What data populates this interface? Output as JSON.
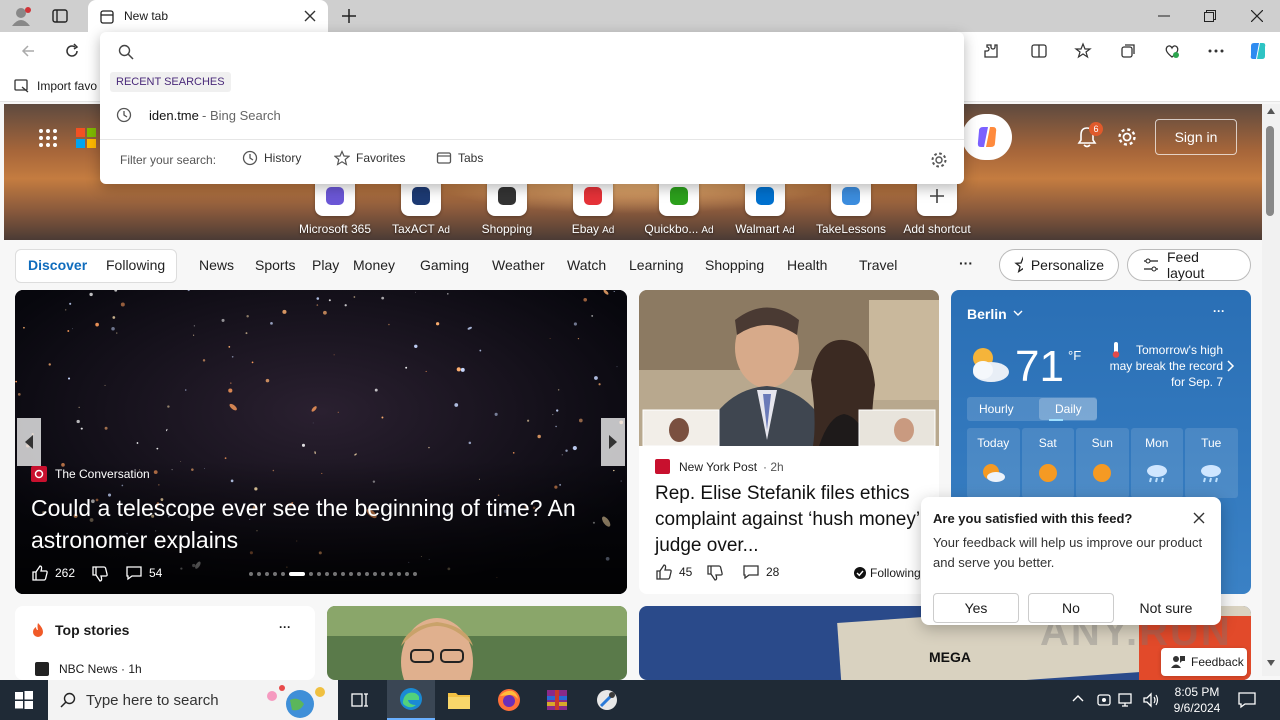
{
  "browser": {
    "tab_title": "New tab",
    "import_favorites": "Import favo"
  },
  "search": {
    "recent_heading": "RECENT SEARCHES",
    "recent": [
      {
        "query": "iden.tme",
        "suffix": " - Bing Search"
      }
    ],
    "filter_label": "Filter your search:",
    "filters": [
      "History",
      "Favorites",
      "Tabs"
    ]
  },
  "hero": {
    "notification_count": "6",
    "sign_in": "Sign in",
    "shortcuts": [
      {
        "label": "Microsoft 365",
        "ad": "",
        "icon": "microsoft365-icon",
        "color": "#6b57d6"
      },
      {
        "label": "TaxACT",
        "ad": "Ad",
        "icon": "taxact-icon",
        "color": "#1d3a73"
      },
      {
        "label": "Shopping",
        "ad": "",
        "icon": "shopping-tag-icon",
        "color": "#333"
      },
      {
        "label": "Ebay",
        "ad": "Ad",
        "icon": "ebay-icon",
        "color": "#e53238"
      },
      {
        "label": "Quickbo...",
        "ad": "Ad",
        "icon": "quickbooks-icon",
        "color": "#2ca01c"
      },
      {
        "label": "Walmart",
        "ad": "Ad",
        "icon": "walmart-icon",
        "color": "#0071ce"
      },
      {
        "label": "TakeLessons",
        "ad": "",
        "icon": "takelessons-icon",
        "color": "#3c8dde"
      },
      {
        "label": "Add shortcut",
        "ad": "",
        "icon": "plus-icon",
        "color": "#444"
      }
    ]
  },
  "nav": {
    "tabs": [
      "Discover",
      "Following"
    ],
    "categories": [
      "News",
      "Sports",
      "Play",
      "Money",
      "Gaming",
      "Weather",
      "Watch",
      "Learning",
      "Shopping",
      "Health",
      "Travel"
    ],
    "more": "···",
    "personalize": "Personalize",
    "feed_layout": "Feed layout"
  },
  "articles": {
    "main": {
      "source": "The Conversation",
      "title": "Could a telescope ever see the beginning of time? An astronomer explains",
      "likes": "262",
      "comments": "54"
    },
    "second": {
      "source": "New York Post",
      "age": "2h",
      "title": "Rep. Elise Stefanik files ethics complaint against ‘hush money’ judge over...",
      "likes": "45",
      "comments": "28",
      "following": "Following"
    },
    "top_stories": {
      "heading": "Top stories",
      "first_source": "NBC News · 1h"
    }
  },
  "weather": {
    "city": "Berlin",
    "temp": "71",
    "unit": "°F",
    "note": "Tomorrow's high may break the record for Sep. 7",
    "toggle": [
      "Hourly",
      "Daily"
    ],
    "days": [
      "Today",
      "Sat",
      "Sun",
      "Mon",
      "Tue"
    ]
  },
  "feedback": {
    "title": "Are you satisfied with this feed?",
    "body": "Your feedback will help us improve our product and serve you better.",
    "yes": "Yes",
    "no": "No",
    "not_sure": "Not sure",
    "button": "Feedback"
  },
  "taskbar": {
    "search_placeholder": "Type here to search",
    "time": "8:05 PM",
    "date": "9/6/2024"
  },
  "watermark": "ANY.RUN"
}
